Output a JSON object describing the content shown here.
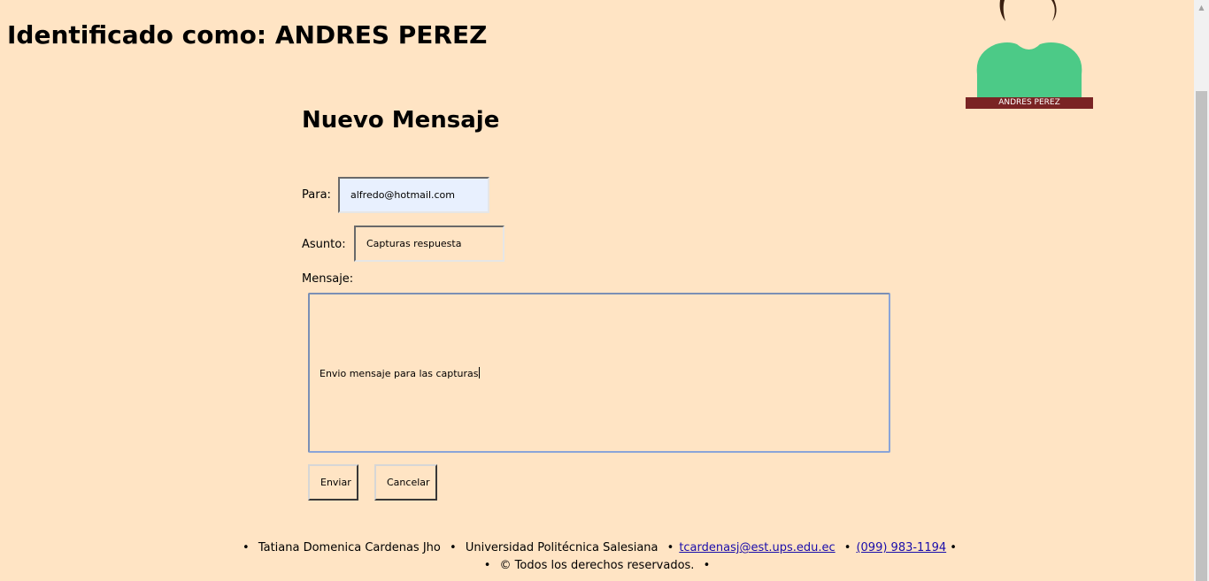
{
  "header": {
    "identified_as": "Identificado como: ANDRES PEREZ"
  },
  "avatar": {
    "name": "ANDRES PEREZ",
    "colors": {
      "hair": "#3a1f10",
      "shirt": "#4cca87",
      "name_bar": "#7a2424"
    }
  },
  "compose": {
    "title": "Nuevo Mensaje",
    "to_label": "Para:",
    "to_value": "alfredo@hotmail.com",
    "subject_label": "Asunto:",
    "subject_value": "Capturas respuesta",
    "message_label": "Mensaje:",
    "message_value": "Envio mensaje para las capturas",
    "send_label": "Enviar",
    "cancel_label": "Cancelar"
  },
  "footer": {
    "author": "Tatiana Domenica Cardenas Jho",
    "university": "Universidad Politécnica Salesiana",
    "email": "tcardenasj@est.ups.edu.ec",
    "phone": "(099) 983-1194",
    "rights": "© Todos los derechos reservados.",
    "bullet": "•"
  },
  "colors": {
    "background": "#ffe4c4",
    "to_field_bg": "#e8f0fe",
    "link": "#1a0dab"
  }
}
